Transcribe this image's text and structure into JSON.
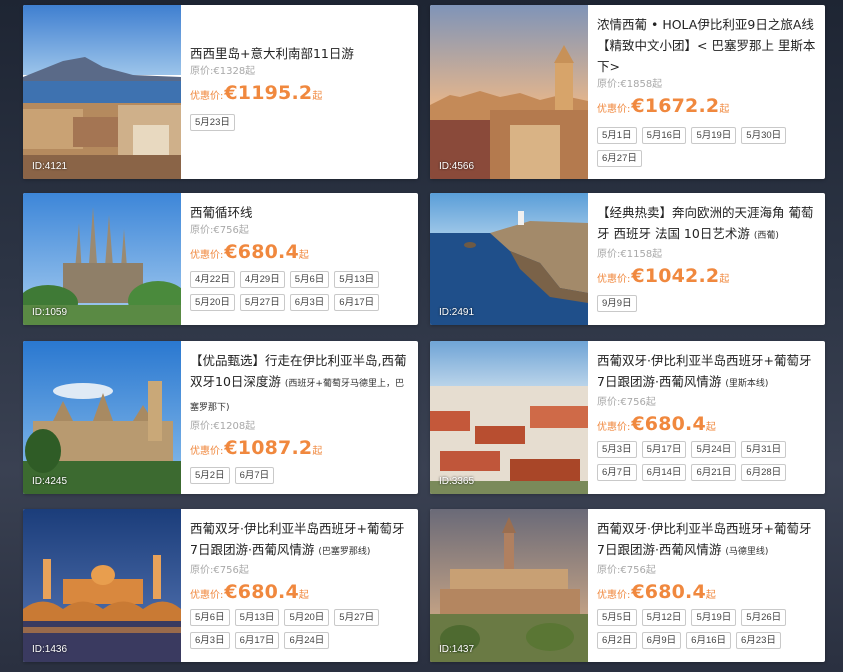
{
  "tours": [
    {
      "id_label": "ID:4121",
      "title": "西西里岛+意大利南部11日游",
      "title_note": "",
      "orig": "原价:€1328起",
      "price_label": "优惠价:",
      "price": "€1195.2",
      "price_suffix": "起",
      "dates": [
        "5月23日"
      ]
    },
    {
      "id_label": "ID:4566",
      "title": "浓情西葡 • HOLA伊比利亚9日之旅A线【精致中文小团】< 巴塞罗那上 里斯本下>",
      "title_note": "",
      "orig": "原价:€1858起",
      "price_label": "优惠价:",
      "price": "€1672.2",
      "price_suffix": "起",
      "dates": [
        "5月1日",
        "5月16日",
        "5月19日",
        "5月30日",
        "6月27日"
      ]
    },
    {
      "id_label": "ID:1059",
      "title": "西葡循环线",
      "title_note": "",
      "orig": "原价:€756起",
      "price_label": "优惠价:",
      "price": "€680.4",
      "price_suffix": "起",
      "dates": [
        "4月22日",
        "4月29日",
        "5月6日",
        "5月13日",
        "5月20日",
        "5月27日",
        "6月3日",
        "6月17日"
      ]
    },
    {
      "id_label": "ID:2491",
      "title": "【经典热卖】奔向欧洲的天涯海角 葡萄牙 西班牙 法国 10日艺术游",
      "title_note": "(西葡)",
      "orig": "原价:€1158起",
      "price_label": "优惠价:",
      "price": "€1042.2",
      "price_suffix": "起",
      "dates": [
        "9月9日"
      ]
    },
    {
      "id_label": "ID:4245",
      "title": "【优品甄选】行走在伊比利亚半岛,西葡双牙10日深度游",
      "title_note": "(西班牙+葡萄牙马德里上，巴塞罗那下)",
      "orig": "原价:€1208起",
      "price_label": "优惠价:",
      "price": "€1087.2",
      "price_suffix": "起",
      "dates": [
        "5月2日",
        "6月7日"
      ]
    },
    {
      "id_label": "ID:3365",
      "title": "西葡双牙·伊比利亚半岛西班牙+葡萄牙7日跟团游·西葡风情游",
      "title_note": "(里斯本线)",
      "orig": "原价:€756起",
      "price_label": "优惠价:",
      "price": "€680.4",
      "price_suffix": "起",
      "dates": [
        "5月3日",
        "5月17日",
        "5月24日",
        "5月31日",
        "6月7日",
        "6月14日",
        "6月21日",
        "6月28日"
      ]
    },
    {
      "id_label": "ID:1436",
      "title": "西葡双牙·伊比利亚半岛西班牙+葡萄牙7日跟团游·西葡风情游",
      "title_note": "(巴塞罗那线)",
      "orig": "原价:€756起",
      "price_label": "优惠价:",
      "price": "€680.4",
      "price_suffix": "起",
      "dates": [
        "5月6日",
        "5月13日",
        "5月20日",
        "5月27日",
        "6月3日",
        "6月17日",
        "6月24日"
      ]
    },
    {
      "id_label": "ID:1437",
      "title": "西葡双牙·伊比利亚半岛西班牙+葡萄牙7日跟团游·西葡风情游",
      "title_note": "(马德里线)",
      "orig": "原价:€756起",
      "price_label": "优惠价:",
      "price": "€680.4",
      "price_suffix": "起",
      "dates": [
        "5月5日",
        "5月12日",
        "5月19日",
        "5月26日",
        "6月2日",
        "6月9日",
        "6月16日",
        "6月23日"
      ]
    }
  ],
  "colors": {
    "price": "#f0883e",
    "orig": "#a8a8a8",
    "title": "#222222",
    "background": "#2c3444"
  }
}
